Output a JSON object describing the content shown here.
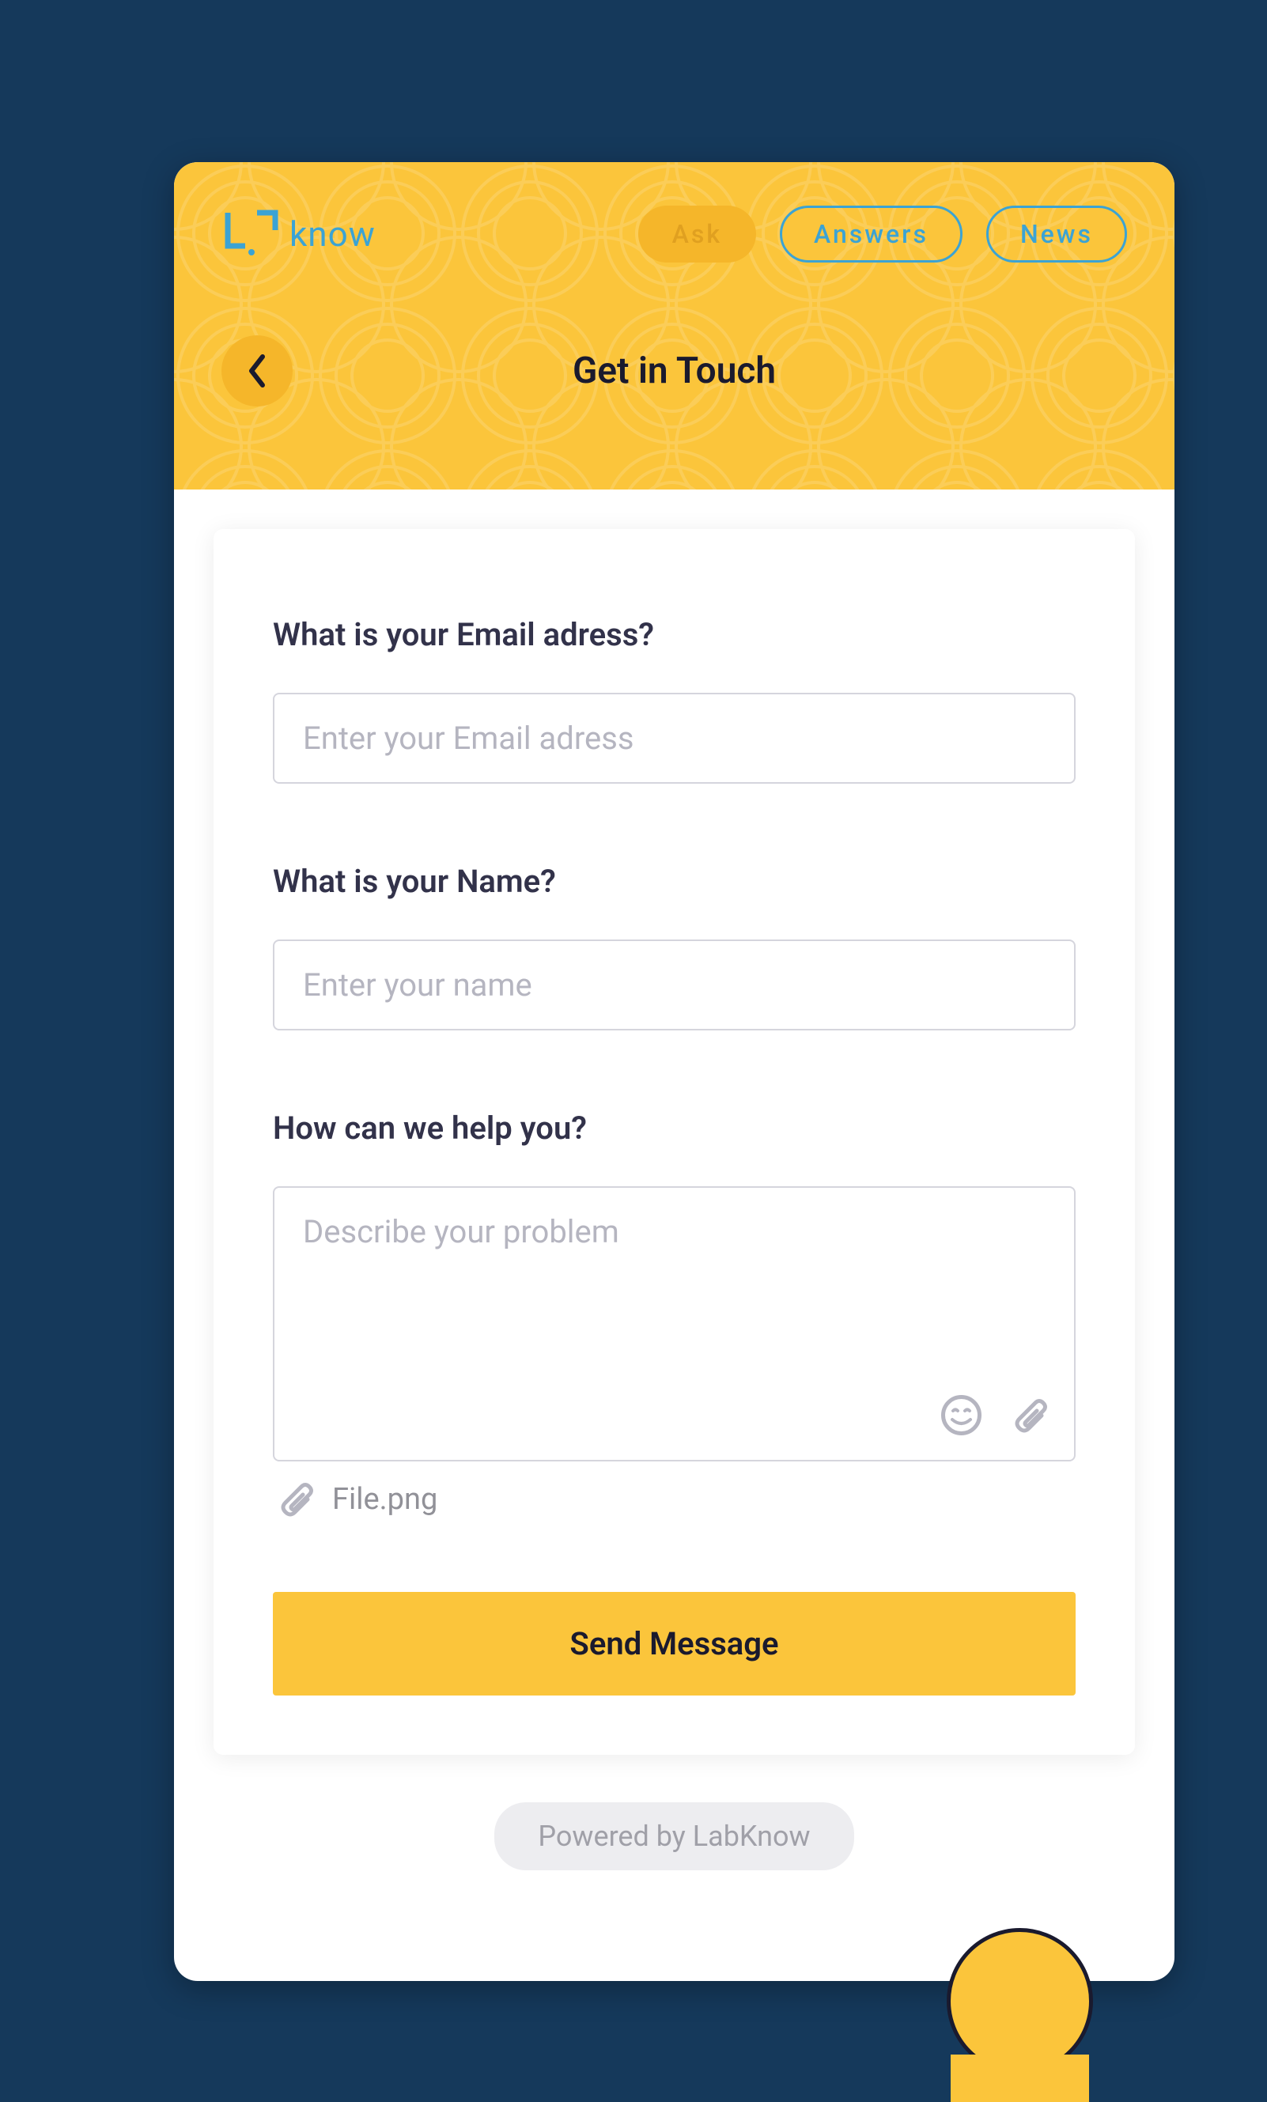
{
  "brand": {
    "logo_text": "know"
  },
  "nav": {
    "ask": "Ask",
    "answers": "Answers",
    "news": "News"
  },
  "page": {
    "title": "Get in Touch"
  },
  "form": {
    "email_label": "What is your Email adress?",
    "email_placeholder": "Enter your Email adress",
    "email_value": "",
    "name_label": "What is your Name?",
    "name_placeholder": "Enter your name",
    "name_value": "",
    "help_label": "How can we help you?",
    "help_placeholder": "Describe your problem",
    "help_value": "",
    "attachment_name": "File.png",
    "submit_label": "Send Message"
  },
  "footer": {
    "powered_by": "Powered by LabKnow"
  }
}
